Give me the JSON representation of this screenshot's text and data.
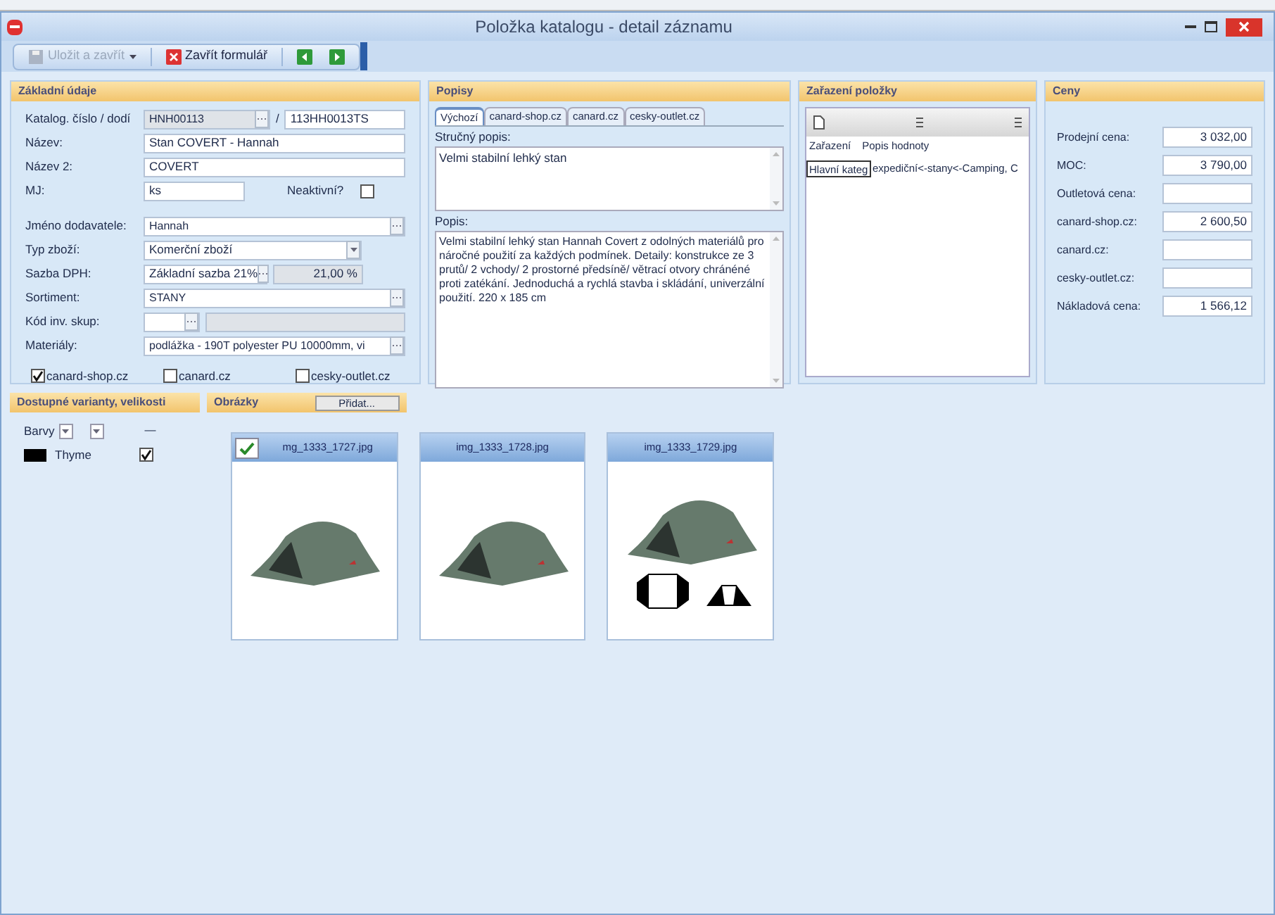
{
  "window": {
    "title": "Položka katalogu - detail záznamu"
  },
  "toolbar": {
    "buttons": [
      {
        "kind": "save",
        "label": "Uložit a zavřít",
        "disabled": true
      },
      {
        "kind": "close",
        "label": "Zavřít formulář",
        "disabled": false
      },
      {
        "kind": "prev",
        "disabled": false
      },
      {
        "kind": "next",
        "disabled": false
      }
    ]
  },
  "basic": {
    "header": "Základní údaje",
    "rows": [
      {
        "label": "Katalog. číslo / dodí",
        "fields": [
          {
            "kind": "lookup",
            "value": "HNH00113",
            "readonly": true
          },
          {
            "kind": "sep",
            "value": "/"
          },
          {
            "kind": "text",
            "value": "113HH0013TS"
          }
        ]
      },
      {
        "label": "Název:",
        "fields": [
          {
            "kind": "text",
            "value": "Stan COVERT - Hannah"
          }
        ]
      },
      {
        "label": "Název 2:",
        "fields": [
          {
            "kind": "text",
            "value": "COVERT"
          }
        ]
      },
      {
        "label": "MJ:",
        "fields": [
          {
            "kind": "short",
            "value": "ks"
          },
          {
            "kind": "check",
            "label": "Neaktivní?",
            "checked": false
          }
        ]
      },
      {
        "label": "Jméno dodavatele:",
        "fields": [
          {
            "kind": "lookup",
            "value": "Hannah",
            "readonly": false
          }
        ]
      },
      {
        "label": "Typ zboží:",
        "fields": [
          {
            "kind": "combo",
            "value": "Komerční zboží"
          }
        ]
      },
      {
        "label": "Sazba DPH:",
        "fields": [
          {
            "kind": "lookupshort",
            "value": "Základní sazba 21%"
          },
          {
            "kind": "number",
            "value": "21,00 %"
          }
        ]
      },
      {
        "label": "Sortiment:",
        "fields": [
          {
            "kind": "lookup",
            "value": "STANY",
            "readonly": false
          }
        ]
      },
      {
        "label": "Kód inv. skup:",
        "fields": [
          {
            "kind": "lookuptiny"
          },
          {
            "kind": "grey"
          }
        ]
      },
      {
        "label": "Materiály:",
        "fields": [
          {
            "kind": "lookup",
            "value": "podlážka - 190T polyester PU 10000mm, vi",
            "readonly": false
          }
        ]
      }
    ],
    "shops": [
      {
        "label": "canard-shop.cz",
        "checked": true
      },
      {
        "label": "canard.cz",
        "checked": false
      },
      {
        "label": "cesky-outlet.cz",
        "checked": false
      }
    ]
  },
  "descriptions": {
    "header": "Popisy",
    "tabs": [
      {
        "label": "Výchozí",
        "selected": true
      },
      {
        "label": "canard-shop.cz",
        "selected": false
      },
      {
        "label": "canard.cz",
        "selected": false
      },
      {
        "label": "cesky-outlet.cz",
        "selected": false
      }
    ],
    "short_label": "Stručný popis:",
    "short_value": "Velmi stabilní lehký stan",
    "long_label": "Popis:",
    "long_value": "Velmi stabilní lehký stan Hannah Covert z odolných materiálů pro náročné použití za každých podmínek. Detaily: konstrukce ze 3 prutů/ 2 vchody/ 2 prostorné předsíně/ větrací otvory chránéné proti zatékání. Jednoduchá a rychlá stavba i skládání, univerzální použití. 220 x 185 cm"
  },
  "categorization": {
    "header": "Zařazení položky",
    "columns": [
      "Zařazení",
      "Popis hodnoty"
    ],
    "rows": [
      {
        "cells": [
          "Hlavní kateg",
          "expediční<-stany<-Camping, C"
        ]
      }
    ]
  },
  "prices": {
    "header": "Ceny",
    "rows": [
      {
        "label": "Prodejní cena:",
        "value": "3 032,00"
      },
      {
        "label": "MOC:",
        "value": "3 790,00"
      },
      {
        "label": "Outletová cena:"
      },
      {
        "label": "canard-shop.cz:",
        "value": "2 600,50"
      },
      {
        "label": "canard.cz:"
      },
      {
        "label": "cesky-outlet.cz:"
      },
      {
        "label": "Nákladová cena:",
        "value": "1 566,12"
      }
    ]
  },
  "variants": {
    "header": "Dostupné varianty, velikosti",
    "column_label": "Barvy",
    "dash": "—",
    "rows": [
      {
        "name": "Thyme",
        "color": "#000000",
        "checked": true
      }
    ]
  },
  "images": {
    "header": "Obrázky",
    "add_button": "Přidat...",
    "items": [
      {
        "filename": "mg_1333_1727.jpg",
        "selected": true,
        "kind": "tent"
      },
      {
        "filename": "img_1333_1728.jpg",
        "selected": false,
        "kind": "tent"
      },
      {
        "filename": "img_1333_1729.jpg",
        "selected": false,
        "kind": "tent-plan"
      }
    ]
  }
}
